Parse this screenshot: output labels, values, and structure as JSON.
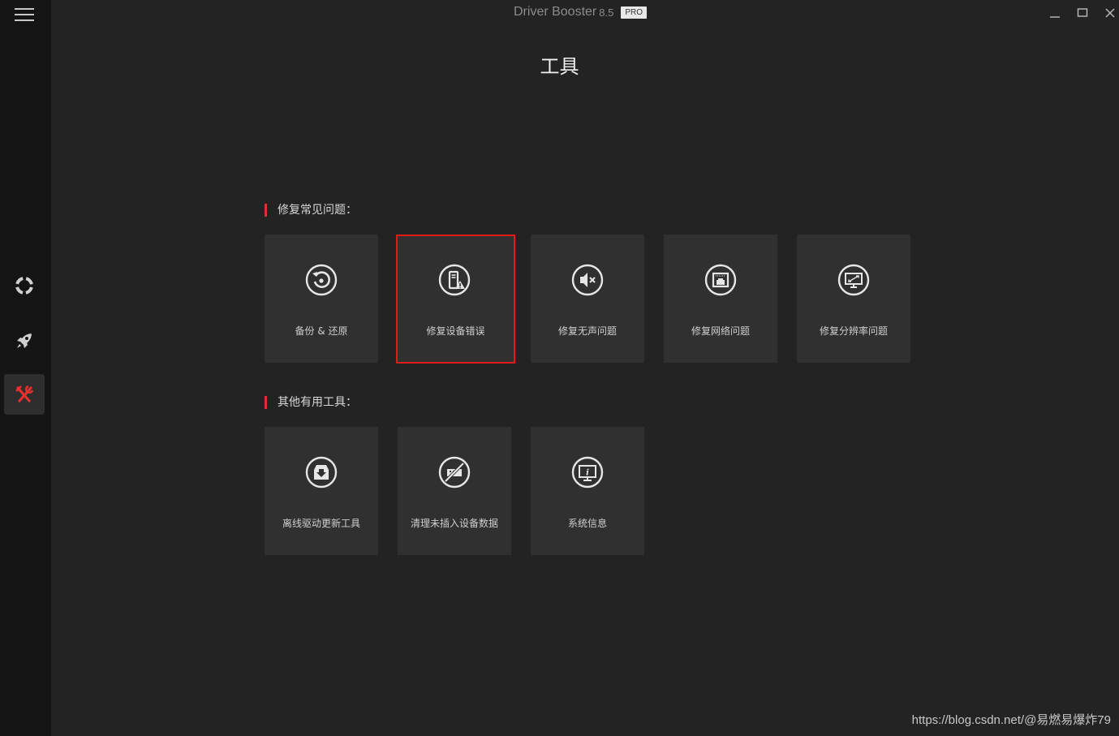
{
  "app": {
    "name": "Driver Booster",
    "version": "8.5",
    "badge": "PRO"
  },
  "page": {
    "title": "工具"
  },
  "sidebar": {
    "items": [
      {
        "icon": "lifebuoy-icon",
        "active": false
      },
      {
        "icon": "rocket-icon",
        "active": false
      },
      {
        "icon": "tools-icon",
        "active": true
      }
    ]
  },
  "sections": {
    "common": {
      "label": "修复常见问题：",
      "tiles": [
        {
          "label": "备份 & 还原",
          "icon": "backup-restore-icon"
        },
        {
          "label": "修复设备错误",
          "icon": "device-error-icon"
        },
        {
          "label": "修复无声问题",
          "icon": "mute-speaker-icon"
        },
        {
          "label": "修复网络问题",
          "icon": "network-icon"
        },
        {
          "label": "修复分辨率问题",
          "icon": "resolution-icon"
        }
      ]
    },
    "other": {
      "label": "其他有用工具：",
      "tiles": [
        {
          "label": "离线驱动更新工具",
          "icon": "offline-update-icon"
        },
        {
          "label": "清理未插入设备数据",
          "icon": "unplugged-device-icon"
        },
        {
          "label": "系统信息",
          "icon": "system-info-icon"
        }
      ]
    }
  },
  "watermark": "https://blog.csdn.net/@易燃易爆炸79",
  "colors": {
    "accent": "#e03030",
    "highlight": "#e31a1a",
    "tile_bg": "#303030",
    "bg": "#232323",
    "sidebar_bg": "#141414"
  }
}
